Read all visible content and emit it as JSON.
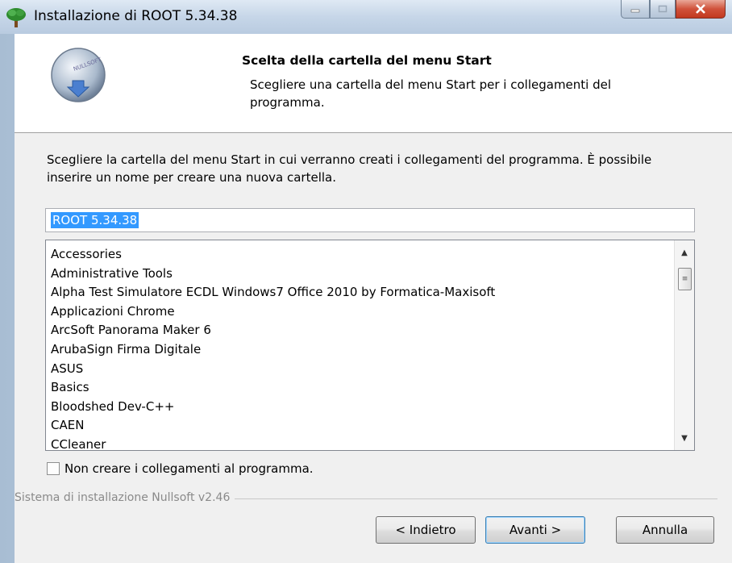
{
  "window": {
    "title": "Installazione di ROOT 5.34.38",
    "controls": {
      "minimize": "minimize",
      "maximize": "maximize",
      "close": "close"
    }
  },
  "header": {
    "title": "Scelta della cartella del menu Start",
    "subtitle": "Scegliere una cartella del menu Start per i collegamenti del programma.",
    "icon_text": "NULLSOFT"
  },
  "description": "Scegliere la cartella del menu Start in cui verranno creati i collegamenti del programma. È possibile inserire un nome per creare una nuova cartella.",
  "folder_input": {
    "value": "ROOT 5.34.38"
  },
  "folder_list": {
    "items": [
      "Accessories",
      "Administrative Tools",
      "Alpha Test Simulatore ECDL Windows7 Office 2010 by Formatica-Maxisoft",
      "Applicazioni Chrome",
      "ArcSoft Panorama Maker 6",
      "ArubaSign Firma Digitale",
      "ASUS",
      "Basics",
      "Bloodshed Dev-C++",
      "CAEN",
      "CCleaner"
    ]
  },
  "checkbox": {
    "label": "Non creare i collegamenti al programma.",
    "checked": false
  },
  "footer": {
    "branding": "Sistema di installazione Nullsoft v2.46"
  },
  "buttons": {
    "back": "< Indietro",
    "next": "Avanti >",
    "cancel": "Annulla"
  },
  "colors": {
    "selection": "#3399ff",
    "close_button": "#c2381f",
    "dialog_bg": "#f0f0f0"
  }
}
